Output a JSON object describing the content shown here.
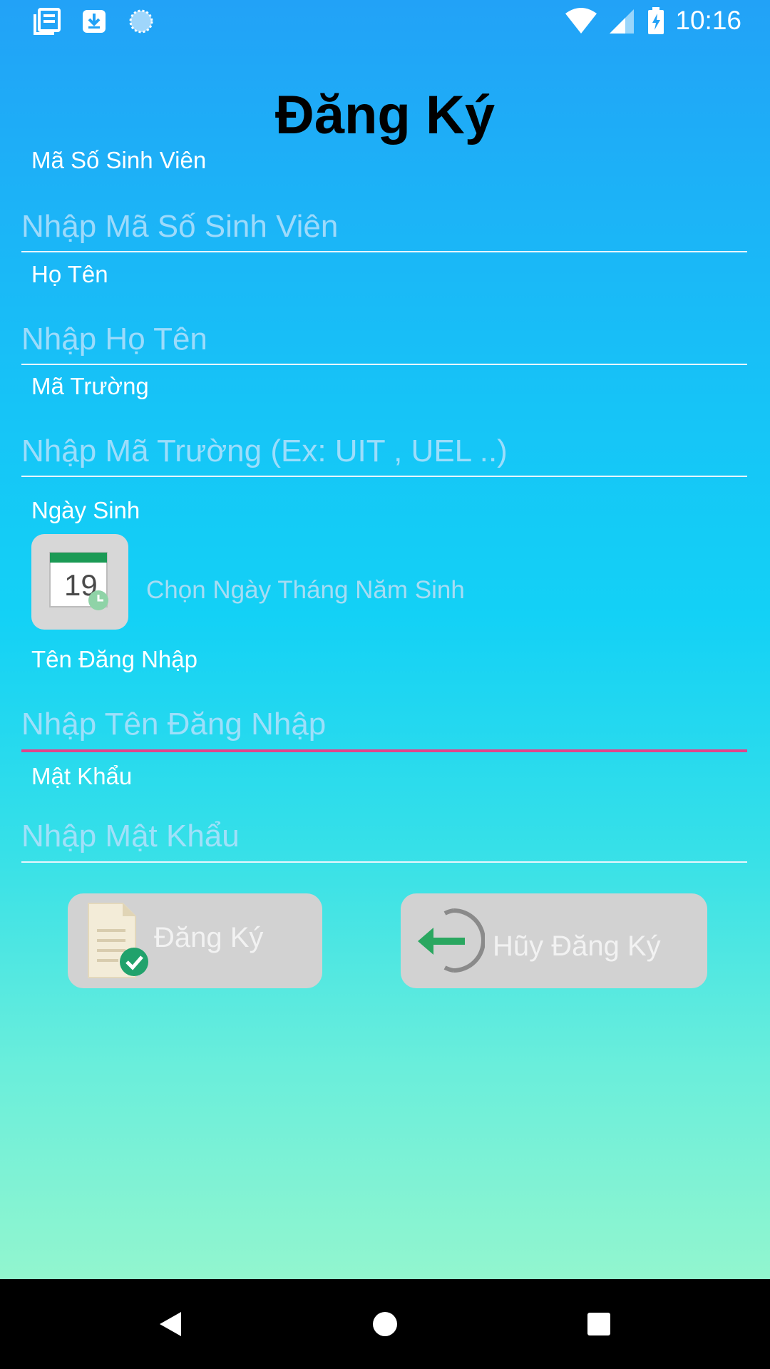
{
  "status_bar": {
    "time": "10:16",
    "left_icons": [
      "news-icon",
      "download-icon",
      "sync-icon"
    ],
    "right_icons": [
      "wifi-icon",
      "signal-icon",
      "battery-charging-icon"
    ]
  },
  "page": {
    "title": "Đăng Ký"
  },
  "form": {
    "student_id": {
      "label": "Mã Số Sinh Viên",
      "placeholder": "Nhập Mã Số Sinh Viên",
      "value": ""
    },
    "full_name": {
      "label": "Họ Tên",
      "placeholder": "Nhập Họ Tên",
      "value": ""
    },
    "school_code": {
      "label": "Mã Trường",
      "placeholder": "Nhập Mã Trường (Ex: UIT , UEL ..)",
      "value": ""
    },
    "birthday": {
      "label": "Ngày Sinh",
      "icon": "calendar-icon",
      "calendar_day": "19",
      "hint": "Chọn Ngày Tháng Năm Sinh"
    },
    "username": {
      "label": "Tên Đăng Nhập",
      "placeholder": "Nhập Tên Đăng Nhập",
      "value": ""
    },
    "password": {
      "label": "Mật Khẩu",
      "placeholder": "Nhập Mật Khẩu",
      "value": ""
    }
  },
  "buttons": {
    "register": {
      "label": "Đăng Ký",
      "icon": "document-check-icon"
    },
    "cancel": {
      "label": "Hũy Đăng Ký",
      "icon": "exit-arrow-icon"
    }
  },
  "nav_bar": {
    "icons": [
      "back-icon",
      "home-icon",
      "recents-icon"
    ]
  },
  "colors": {
    "gradient_top": "#22a2f7",
    "gradient_bottom": "#a3f9c9",
    "focus_underline": "#e0458b",
    "button_bg": "#d2d2d2"
  }
}
